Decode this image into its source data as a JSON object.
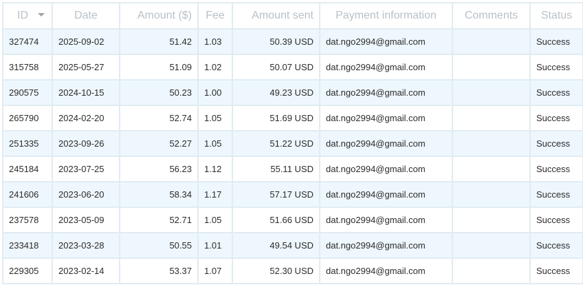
{
  "headers": {
    "id": "ID",
    "date": "Date",
    "amount": "Amount ($)",
    "fee": "Fee",
    "amount_sent": "Amount sent",
    "payment_info": "Payment information",
    "comments": "Comments",
    "status": "Status"
  },
  "sort": {
    "column": "ID",
    "direction": "descending",
    "icon": "sort-desc-icon"
  },
  "rows": [
    {
      "id": "327474",
      "date": "2025-09-02",
      "amount": "51.42",
      "fee": "1.03",
      "amount_sent": "50.39 USD",
      "payment_info": "dat.ngo2994@gmail.com",
      "comments": "",
      "status": "Success"
    },
    {
      "id": "315758",
      "date": "2025-05-27",
      "amount": "51.09",
      "fee": "1.02",
      "amount_sent": "50.07 USD",
      "payment_info": "dat.ngo2994@gmail.com",
      "comments": "",
      "status": "Success"
    },
    {
      "id": "290575",
      "date": "2024-10-15",
      "amount": "50.23",
      "fee": "1.00",
      "amount_sent": "49.23 USD",
      "payment_info": "dat.ngo2994@gmail.com",
      "comments": "",
      "status": "Success"
    },
    {
      "id": "265790",
      "date": "2024-02-20",
      "amount": "52.74",
      "fee": "1.05",
      "amount_sent": "51.69 USD",
      "payment_info": "dat.ngo2994@gmail.com",
      "comments": "",
      "status": "Success"
    },
    {
      "id": "251335",
      "date": "2023-09-26",
      "amount": "52.27",
      "fee": "1.05",
      "amount_sent": "51.22 USD",
      "payment_info": "dat.ngo2994@gmail.com",
      "comments": "",
      "status": "Success"
    },
    {
      "id": "245184",
      "date": "2023-07-25",
      "amount": "56.23",
      "fee": "1.12",
      "amount_sent": "55.11 USD",
      "payment_info": "dat.ngo2994@gmail.com",
      "comments": "",
      "status": "Success"
    },
    {
      "id": "241606",
      "date": "2023-06-20",
      "amount": "58.34",
      "fee": "1.17",
      "amount_sent": "57.17 USD",
      "payment_info": "dat.ngo2994@gmail.com",
      "comments": "",
      "status": "Success"
    },
    {
      "id": "237578",
      "date": "2023-05-09",
      "amount": "52.71",
      "fee": "1.05",
      "amount_sent": "51.66 USD",
      "payment_info": "dat.ngo2994@gmail.com",
      "comments": "",
      "status": "Success"
    },
    {
      "id": "233418",
      "date": "2023-03-28",
      "amount": "50.55",
      "fee": "1.01",
      "amount_sent": "49.54 USD",
      "payment_info": "dat.ngo2994@gmail.com",
      "comments": "",
      "status": "Success"
    },
    {
      "id": "229305",
      "date": "2023-02-14",
      "amount": "53.37",
      "fee": "1.07",
      "amount_sent": "52.30 USD",
      "payment_info": "dat.ngo2994@gmail.com",
      "comments": "",
      "status": "Success"
    }
  ],
  "colors": {
    "border": "#e1ebf2",
    "header_text": "#b9c1c7",
    "row_alt_bg": "#eef7fd",
    "text": "#2b2b2b"
  }
}
